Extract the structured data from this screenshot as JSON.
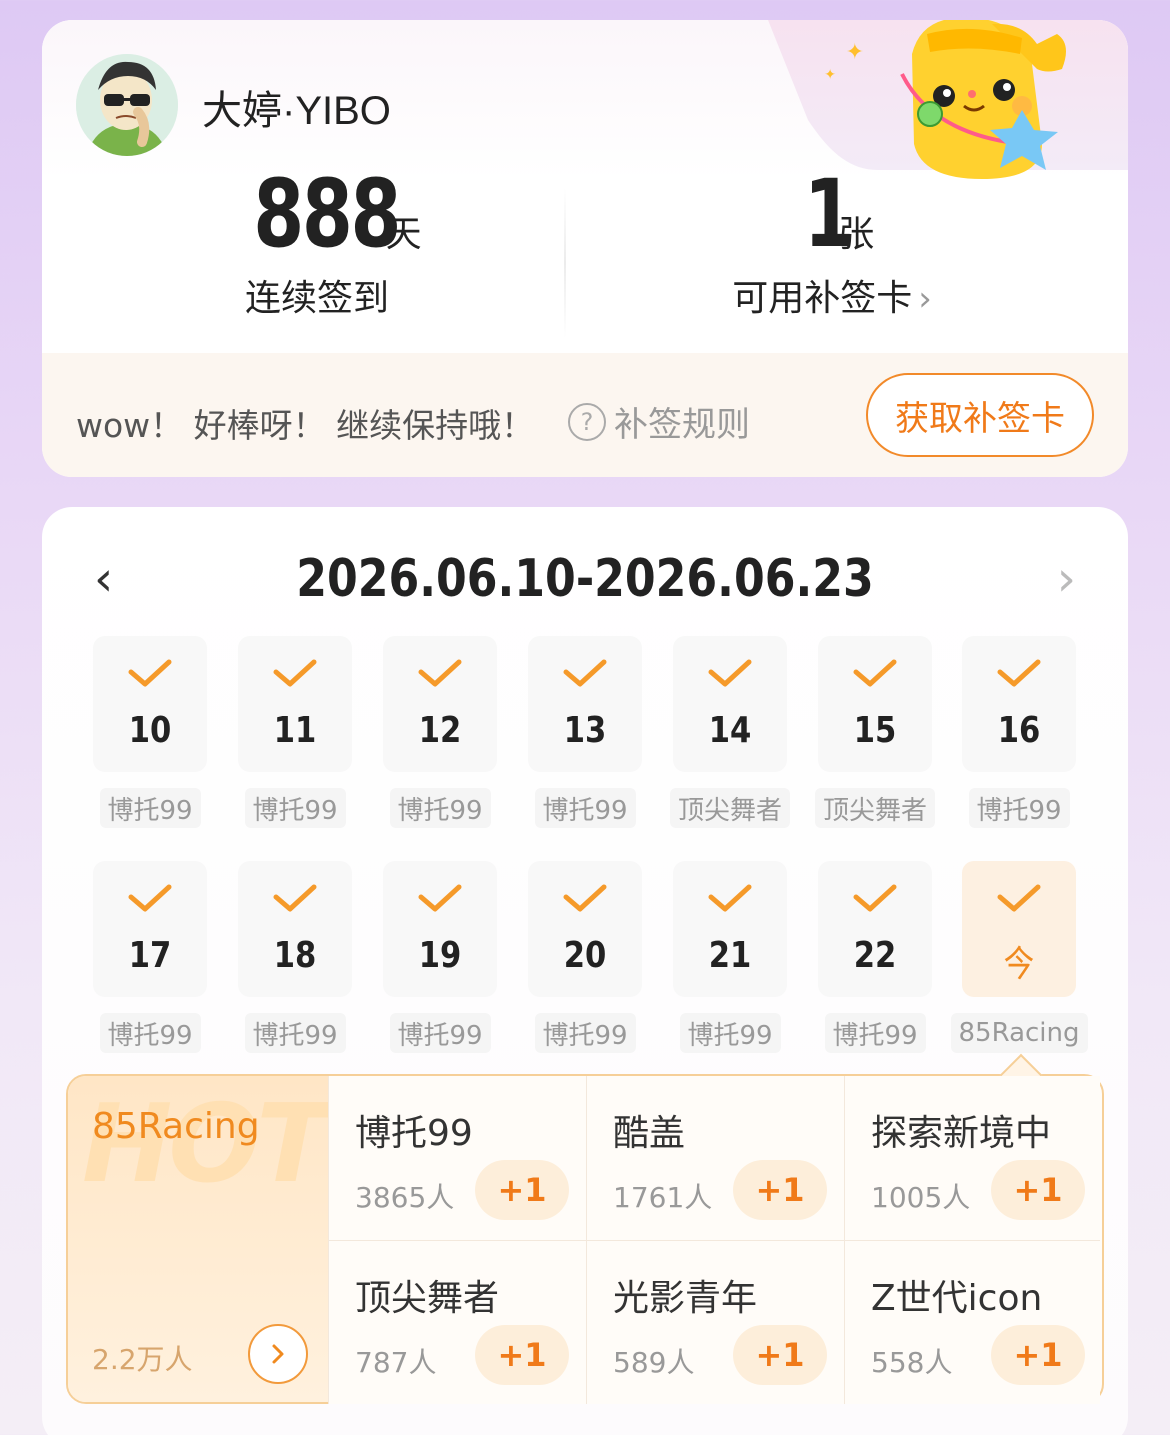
{
  "user": {
    "name": "大婷·YIBO"
  },
  "stats": {
    "streak_value": "888",
    "streak_unit": "天",
    "streak_label": "连续签到",
    "cards_value": "1",
    "cards_unit": "张",
    "cards_label": "可用补签卡",
    "cards_chevron": "›"
  },
  "tip": {
    "message": "wow！ 好棒呀！ 继续保持哦！",
    "rule_icon": "?",
    "rule_label": "补签规则",
    "get_card_label": "获取补签卡"
  },
  "calendar": {
    "range": "2026.06.10-2026.06.23",
    "prev_icon": "‹",
    "next_icon": "›",
    "days": [
      {
        "num": "10",
        "tag": "博托99",
        "checked": true
      },
      {
        "num": "11",
        "tag": "博托99",
        "checked": true
      },
      {
        "num": "12",
        "tag": "博托99",
        "checked": true
      },
      {
        "num": "13",
        "tag": "博托99",
        "checked": true
      },
      {
        "num": "14",
        "tag": "顶尖舞者",
        "checked": true
      },
      {
        "num": "15",
        "tag": "顶尖舞者",
        "checked": true
      },
      {
        "num": "16",
        "tag": "博托99",
        "checked": true
      },
      {
        "num": "17",
        "tag": "博托99",
        "checked": true
      },
      {
        "num": "18",
        "tag": "博托99",
        "checked": true
      },
      {
        "num": "19",
        "tag": "博托99",
        "checked": true
      },
      {
        "num": "20",
        "tag": "博托99",
        "checked": true
      },
      {
        "num": "21",
        "tag": "博托99",
        "checked": true
      },
      {
        "num": "22",
        "tag": "博托99",
        "checked": true
      },
      {
        "num": "今",
        "tag": "85Racing",
        "checked": true,
        "today": true
      }
    ]
  },
  "hot": {
    "watermark": "HOT",
    "featured_name": "85Racing",
    "featured_count": "2.2万人",
    "plus_label": "+1",
    "topics": [
      {
        "name": "博托99",
        "count": "3865人"
      },
      {
        "name": "酷盖",
        "count": "1761人"
      },
      {
        "name": "探索新境中",
        "count": "1005人"
      },
      {
        "name": "顶尖舞者",
        "count": "787人"
      },
      {
        "name": "光影青年",
        "count": "589人"
      },
      {
        "name": "Z世代icon",
        "count": "558人"
      }
    ]
  },
  "colors": {
    "accent": "#f28a2a",
    "check": "#f59a2a"
  }
}
